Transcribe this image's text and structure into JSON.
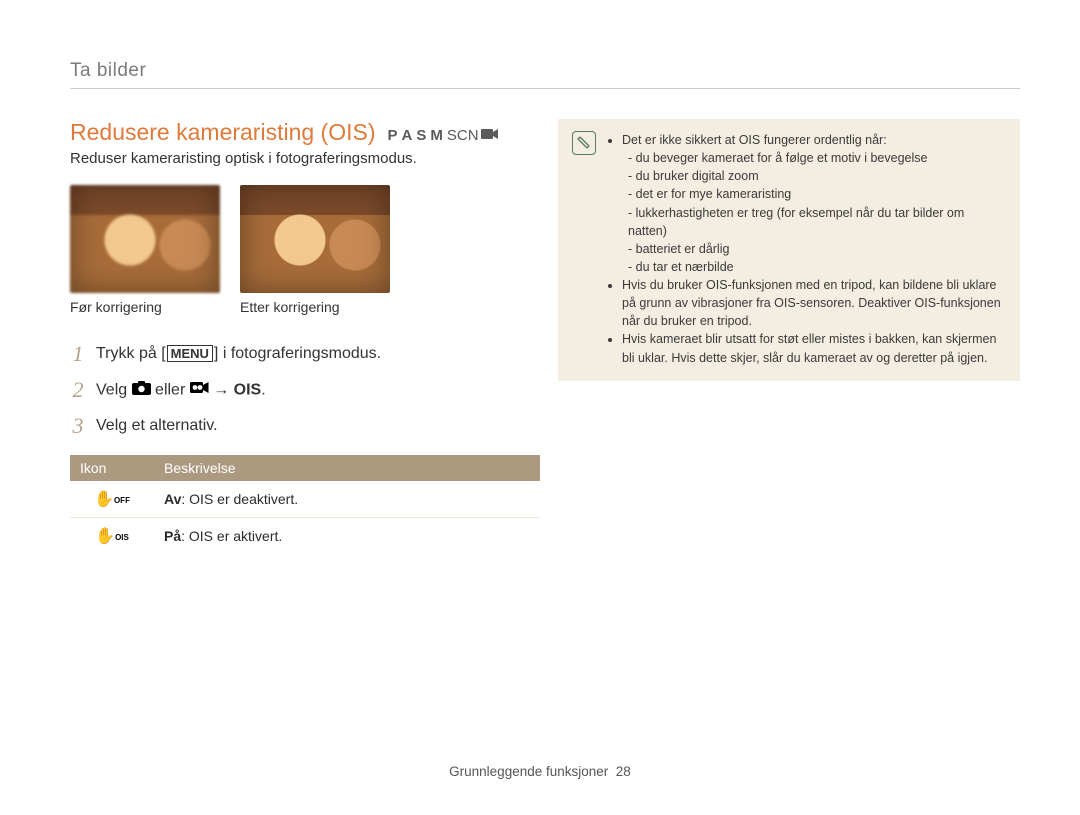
{
  "breadcrumb": "Ta bilder",
  "heading": {
    "title": "Redusere kameraristing (OIS)",
    "modes": {
      "p": "P",
      "a": "A",
      "s": "S",
      "m": "M",
      "scn": "SCN",
      "video_icon": "video"
    },
    "subtitle": "Reduser kameraristing optisk i fotograferingsmodus."
  },
  "photos": {
    "before_caption": "Før korrigering",
    "after_caption": "Etter korrigering"
  },
  "steps": {
    "s1_a": "Trykk på [",
    "s1_menu": "MENU",
    "s1_b": "] i fotograferingsmodus.",
    "s2_a": "Velg ",
    "s2_b": " eller ",
    "s2_c": " → ",
    "s2_d": "OIS",
    "s2_e": ".",
    "s3": "Velg et alternativ."
  },
  "table": {
    "head_icon": "Ikon",
    "head_desc": "Beskrivelse",
    "rows": [
      {
        "sub": "OFF",
        "label": "Av",
        "text": ": OIS er deaktivert."
      },
      {
        "sub": "OIS",
        "label": "På",
        "text": ": OIS er aktivert."
      }
    ]
  },
  "note": {
    "intro": "Det er ikke sikkert at OIS fungerer ordentlig når:",
    "sub": [
      "du beveger kameraet for å følge et motiv i bevegelse",
      "du bruker digital zoom",
      "det er for mye kameraristing",
      "lukkerhastigheten er treg (for eksempel når du tar bilder om natten)",
      "batteriet er dårlig",
      "du tar et nærbilde"
    ],
    "b2": "Hvis du bruker OIS-funksjonen med en tripod, kan bildene bli uklare på grunn av vibrasjoner fra OIS-sensoren. Deaktiver OIS-funksjonen når du bruker en tripod.",
    "b3": "Hvis kameraet blir utsatt for støt eller mistes i bakken, kan skjermen bli uklar. Hvis dette skjer, slår du kameraet av og deretter på igjen."
  },
  "footer": {
    "section": "Grunnleggende funksjoner",
    "page": "28"
  }
}
